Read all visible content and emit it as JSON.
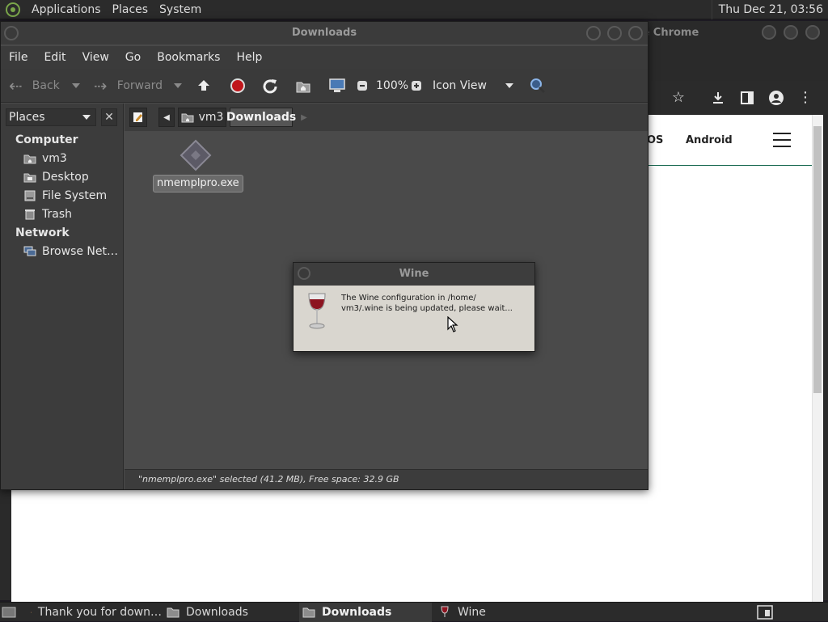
{
  "top_panel": {
    "menus": [
      "Applications",
      "Places",
      "System"
    ],
    "clock": "Thu Dec 21, 03:56"
  },
  "chrome": {
    "title_fragment": "le Chrome",
    "nav_partial": "OS",
    "nav_android": "Android"
  },
  "file_manager": {
    "title": "Downloads",
    "menu": [
      "File",
      "Edit",
      "View",
      "Go",
      "Bookmarks",
      "Help"
    ],
    "toolbar": {
      "back": "Back",
      "forward": "Forward",
      "zoom": "100%",
      "view_mode": "Icon View"
    },
    "side": {
      "combo": "Places",
      "computer_header": "Computer",
      "computer_items": [
        "vm3",
        "Desktop",
        "File System",
        "Trash"
      ],
      "network_header": "Network",
      "network_items": [
        "Browse Net…"
      ]
    },
    "breadcrumb": [
      "vm3",
      "Downloads"
    ],
    "file": {
      "name": "nmemplpro.exe"
    },
    "status": "\"nmemplpro.exe\" selected (41.2 MB), Free space: 32.9 GB"
  },
  "wine_dialog": {
    "title": "Wine",
    "line1": "The Wine configuration in /home/",
    "line2": "vm3/.wine is being updated, please wait..."
  },
  "taskbar": {
    "items": [
      "Thank you for down…",
      "Downloads",
      "Downloads",
      "Wine"
    ]
  }
}
